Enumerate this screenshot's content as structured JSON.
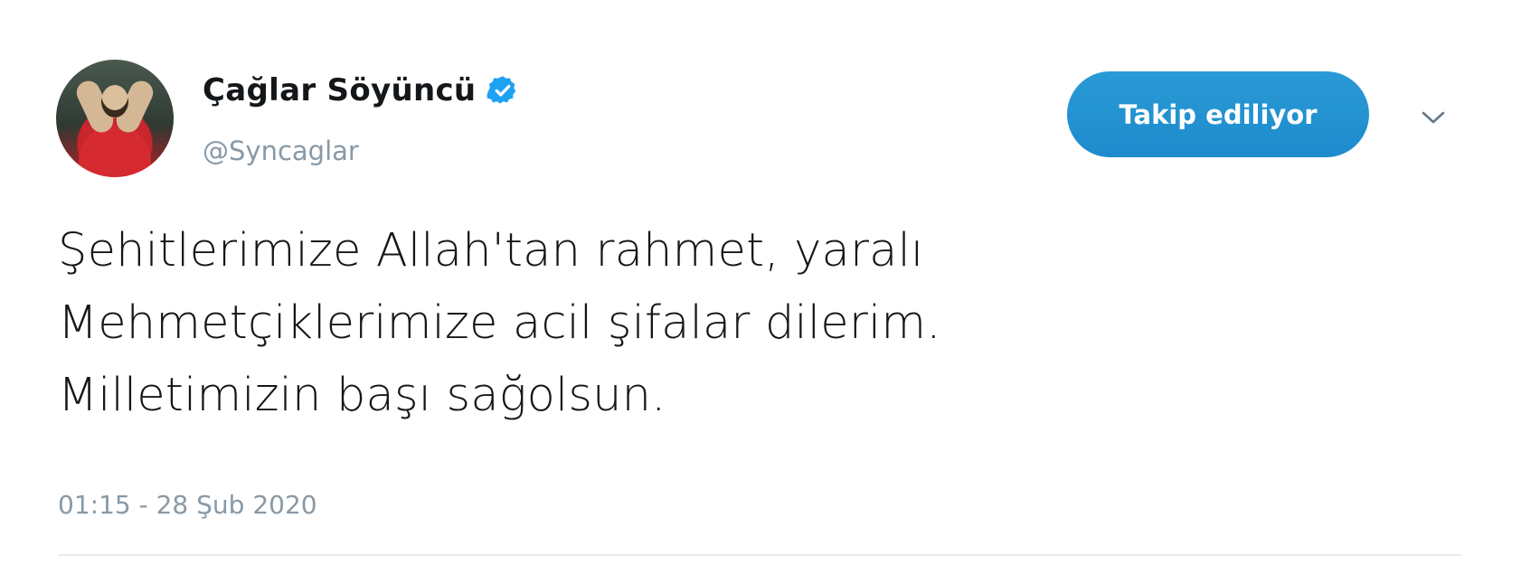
{
  "user": {
    "display_name": "Çağlar Söyüncü",
    "handle": "@Syncaglar",
    "verified_icon": "verified-badge-icon",
    "avatar_icon": "avatar"
  },
  "follow_button": {
    "label": "Takip ediliyor"
  },
  "menu": {
    "icon": "chevron-down-icon"
  },
  "tweet": {
    "lines": [
      "Şehitlerimize Allah'tan rahmet, yaralı",
      "Mehmetçiklerimize acil şifalar dilerim.",
      "Milletimizin başı sağolsun."
    ],
    "timestamp": "01:15 - 28 Şub 2020"
  },
  "colors": {
    "accent": "#1d8fd0",
    "text": "#14171a",
    "muted": "#8899a6"
  }
}
